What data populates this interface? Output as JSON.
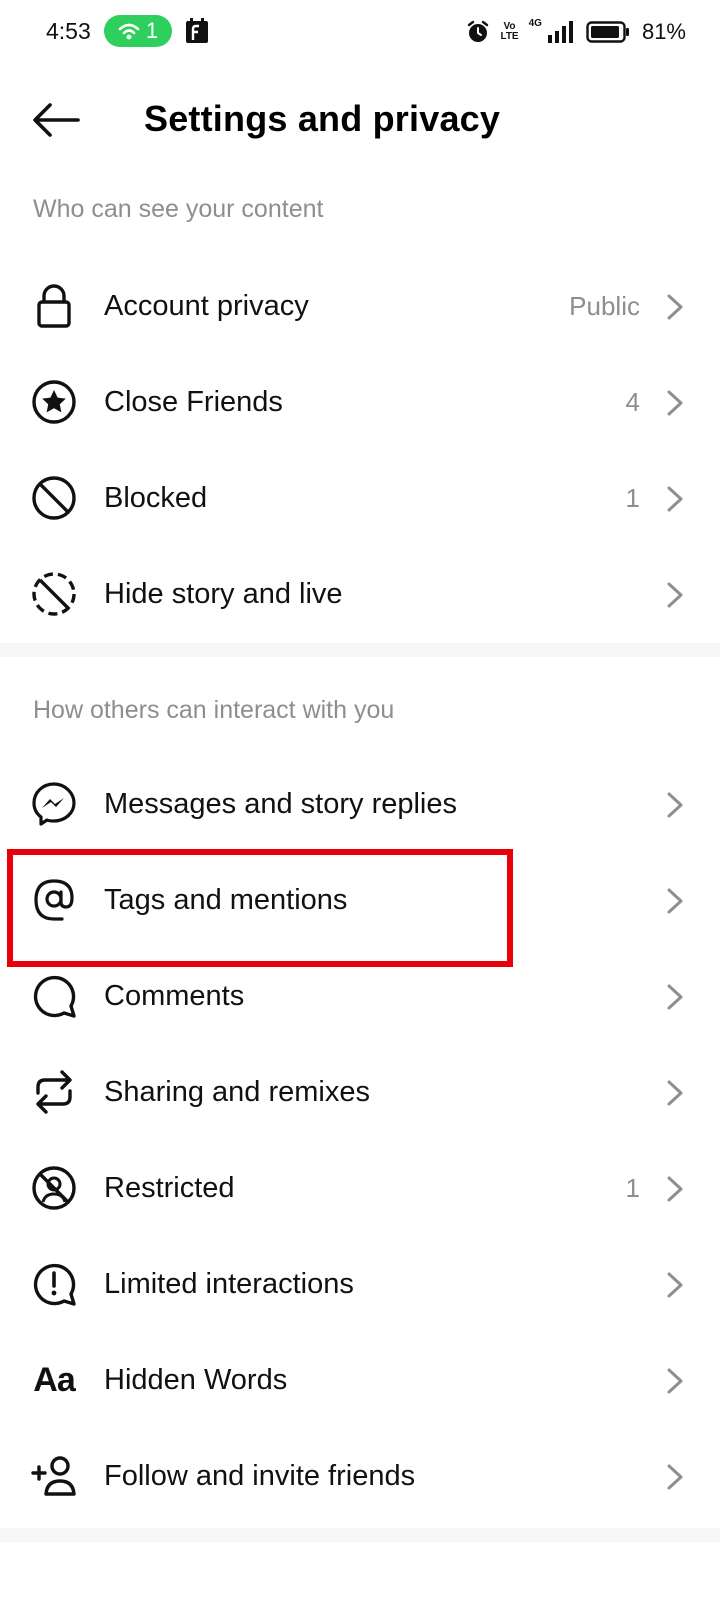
{
  "status_bar": {
    "time": "4:53",
    "hotspot_count": "1",
    "volte_label_1": "Vo",
    "volte_label_2": "LTE",
    "network_label": "4G",
    "battery": "81%",
    "icons": [
      "hotspot-icon",
      "notification-app-icon",
      "alarm-icon",
      "volte-icon",
      "signal-icon",
      "battery-icon"
    ]
  },
  "header": {
    "title": "Settings and privacy",
    "back_icon": "arrow-left-icon"
  },
  "sections": [
    {
      "title": "Who can see your content",
      "items": [
        {
          "label": "Account privacy",
          "value": "Public",
          "icon": "lock-icon"
        },
        {
          "label": "Close Friends",
          "value": "4",
          "icon": "star-circle-icon"
        },
        {
          "label": "Blocked",
          "value": "1",
          "icon": "blocked-icon"
        },
        {
          "label": "Hide story and live",
          "value": "",
          "icon": "hide-story-icon"
        }
      ]
    },
    {
      "title": "How others can interact with you",
      "items": [
        {
          "label": "Messages and story replies",
          "value": "",
          "icon": "messenger-icon"
        },
        {
          "label": "Tags and mentions",
          "value": "",
          "icon": "at-sign-icon"
        },
        {
          "label": "Comments",
          "value": "",
          "icon": "comment-icon"
        },
        {
          "label": "Sharing and remixes",
          "value": "",
          "icon": "remix-icon"
        },
        {
          "label": "Restricted",
          "value": "1",
          "icon": "restricted-icon"
        },
        {
          "label": "Limited interactions",
          "value": "",
          "icon": "limited-interactions-icon"
        },
        {
          "label": "Hidden Words",
          "value": "",
          "icon": "hidden-words-icon"
        },
        {
          "label": "Follow and invite friends",
          "value": "",
          "icon": "add-person-icon"
        }
      ]
    }
  ],
  "hidden_words_icon_text": "Aa",
  "highlight_color": "#e8000b",
  "accent_green": "#2fcf5e"
}
